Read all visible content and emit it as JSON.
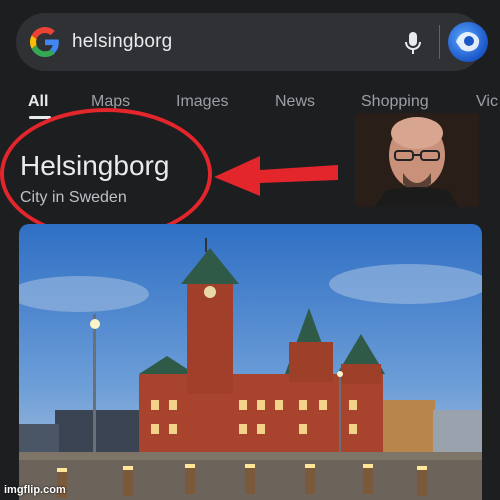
{
  "search": {
    "query": "helsingborg",
    "logo_icon": "google-g-icon",
    "mic_icon": "mic-icon",
    "avatar_icon": "profile-avatar-icon"
  },
  "tabs": [
    {
      "label": "All",
      "active": true
    },
    {
      "label": "Maps",
      "active": false
    },
    {
      "label": "Images",
      "active": false
    },
    {
      "label": "News",
      "active": false
    },
    {
      "label": "Shopping",
      "active": false
    },
    {
      "label": "Vic",
      "active": false
    }
  ],
  "knowledge_panel": {
    "title": "Helsingborg",
    "subtitle": "City in Sweden"
  },
  "annotation": {
    "oval_color": "#e3262b",
    "arrow_color": "#e3262b"
  },
  "watermark": "imgflip.com",
  "colors": {
    "background": "#1d1e20",
    "search_bar": "#303134",
    "text": "#e8eaed",
    "muted": "#9aa0a6"
  }
}
